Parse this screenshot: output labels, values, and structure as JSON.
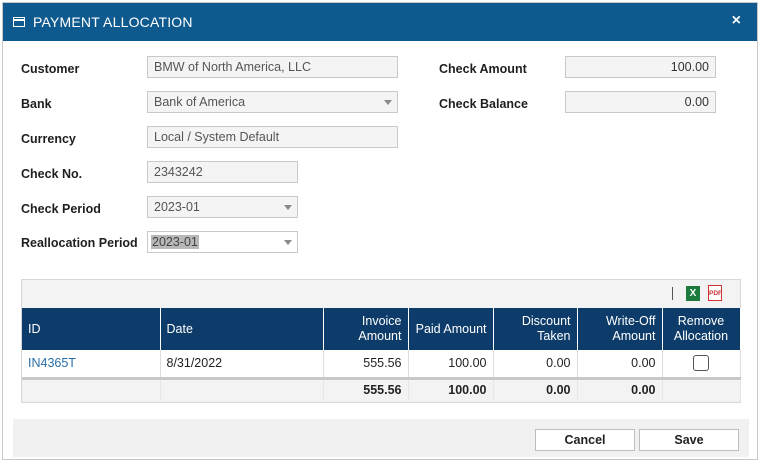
{
  "dialog": {
    "title": "PAYMENT ALLOCATION",
    "close_glyph": "×"
  },
  "form": {
    "customer_label": "Customer",
    "customer_value": "BMW of North America, LLC",
    "bank_label": "Bank",
    "bank_value": "Bank of America",
    "currency_label": "Currency",
    "currency_value": "Local / System Default",
    "check_no_label": "Check No.",
    "check_no_value": "2343242",
    "check_period_label": "Check Period",
    "check_period_value": "2023-01",
    "reallocation_period_label": "Reallocation Period",
    "reallocation_period_value": "2023-01",
    "check_amount_label": "Check Amount",
    "check_amount_value": "100.00",
    "check_balance_label": "Check Balance",
    "check_balance_value": "0.00"
  },
  "toolbar": {
    "excel_icon": "excel-icon",
    "pdf_icon": "pdf-icon",
    "excel_glyph": "X",
    "pdf_glyph": "PDF"
  },
  "grid": {
    "headers": {
      "id": "ID",
      "date": "Date",
      "invoice_amount": "Invoice Amount",
      "paid_amount": "Paid Amount",
      "discount_taken": "Discount Taken",
      "write_off_amount": "Write-Off Amount",
      "remove_allocation": "Remove Allocation"
    },
    "rows": [
      {
        "id": "IN4365T",
        "date": "8/31/2022",
        "invoice_amount": "555.56",
        "paid_amount": "100.00",
        "discount_taken": "0.00",
        "write_off_amount": "0.00",
        "remove_allocation": false
      }
    ],
    "totals": {
      "invoice_amount": "555.56",
      "paid_amount": "100.00",
      "discount_taken": "0.00",
      "write_off_amount": "0.00"
    }
  },
  "footer": {
    "cancel_label": "Cancel",
    "save_label": "Save"
  },
  "colors": {
    "title_bar": "#0e5a8e",
    "grid_header": "#0e3c6a",
    "link": "#2a6ea8"
  }
}
